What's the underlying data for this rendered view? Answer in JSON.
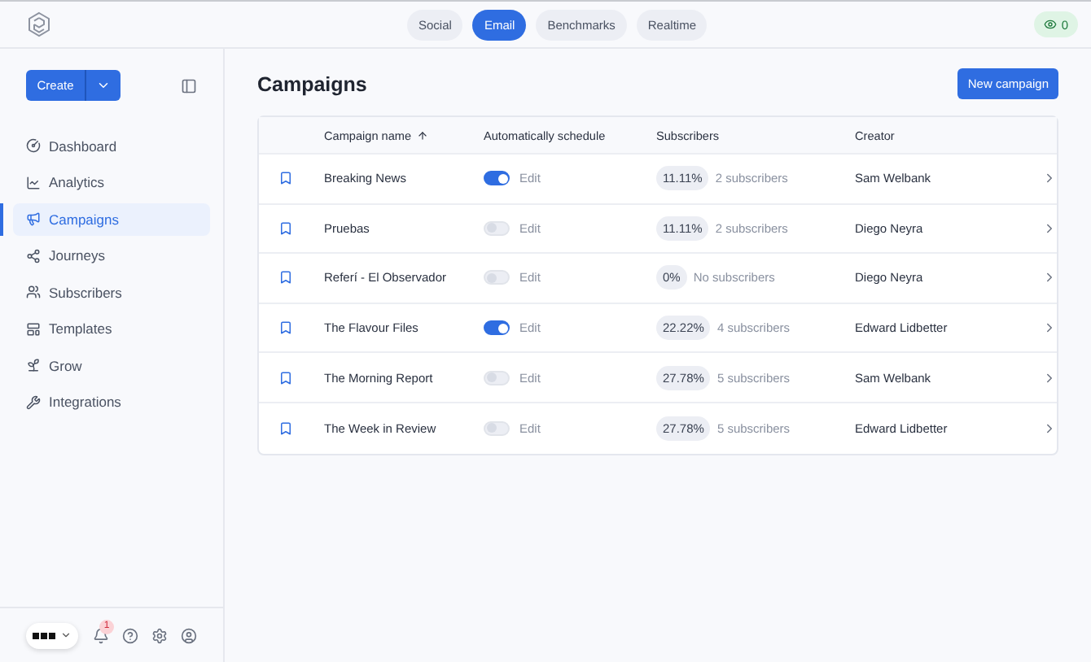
{
  "top_tabs": [
    {
      "label": "Social",
      "selected": false
    },
    {
      "label": "Email",
      "selected": true
    },
    {
      "label": "Benchmarks",
      "selected": false
    },
    {
      "label": "Realtime",
      "selected": false
    }
  ],
  "viewers": "0",
  "create_button": "Create",
  "nav": [
    {
      "label": "Dashboard",
      "selected": false
    },
    {
      "label": "Analytics",
      "selected": false
    },
    {
      "label": "Campaigns",
      "selected": true
    },
    {
      "label": "Journeys",
      "selected": false
    },
    {
      "label": "Subscribers",
      "selected": false
    },
    {
      "label": "Templates",
      "selected": false
    },
    {
      "label": "Grow",
      "selected": false
    },
    {
      "label": "Integrations",
      "selected": false
    }
  ],
  "notifications": "1",
  "page_title": "Campaigns",
  "new_button": "New campaign",
  "table": {
    "columns": [
      "Campaign name",
      "Automatically schedule",
      "Subscribers",
      "Creator"
    ],
    "rows": [
      {
        "name": "Breaking News",
        "auto": true,
        "edit": "Edit",
        "share": "11.11%",
        "subscribers": "2 subscribers",
        "creator": "Sam Welbank"
      },
      {
        "name": "Pruebas",
        "auto": false,
        "edit": "Edit",
        "share": "11.11%",
        "subscribers": "2 subscribers",
        "creator": "Diego Neyra"
      },
      {
        "name": "Referí - El Observador",
        "auto": false,
        "edit": "Edit",
        "share": "0%",
        "subscribers": "No subscribers",
        "creator": "Diego Neyra"
      },
      {
        "name": "The Flavour Files",
        "auto": true,
        "edit": "Edit",
        "share": "22.22%",
        "subscribers": "4 subscribers",
        "creator": "Edward Lidbetter"
      },
      {
        "name": "The Morning Report",
        "auto": false,
        "edit": "Edit",
        "share": "27.78%",
        "subscribers": "5 subscribers",
        "creator": "Sam Welbank"
      },
      {
        "name": "The Week in Review",
        "auto": false,
        "edit": "Edit",
        "share": "27.78%",
        "subscribers": "5 subscribers",
        "creator": "Edward Lidbetter"
      }
    ]
  }
}
